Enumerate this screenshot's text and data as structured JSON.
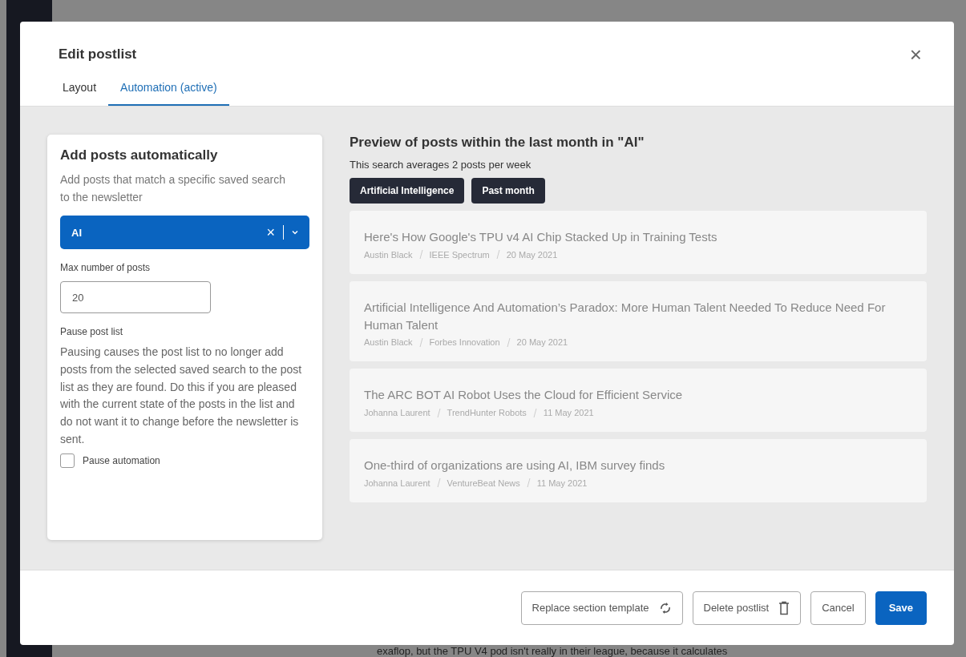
{
  "background_text": "exaflop, but the TPU V4 pod isn't really in their league, because it calculates",
  "dialog": {
    "title": "Edit postlist",
    "close": "×"
  },
  "tabs": [
    {
      "label": "Layout",
      "selected": false
    },
    {
      "label": "Automation (active)",
      "selected": true
    }
  ],
  "automation_card": {
    "title": "Add posts automatically",
    "description": "Add posts that match a specific saved search to the newsletter",
    "saved_search": {
      "value": "AI",
      "clear": "×"
    },
    "max_posts": {
      "label": "Max number of posts",
      "value": "20"
    },
    "pause": {
      "label": "Pause post list",
      "description": "Pausing causes the post list to no longer add posts from the selected saved search to the post list as they are found. Do this if you are pleased with the current state of the posts in the list and do not want it to change before the newsletter is sent.",
      "checkbox_label": "Pause automation",
      "checked": false
    }
  },
  "preview": {
    "title": "Preview of posts within the last month in \"AI\"",
    "subtitle": "This search averages 2 posts per week",
    "tags": [
      "Artificial Intelligence",
      "Past month"
    ],
    "posts": [
      {
        "title": "Here's How Google's TPU v4 AI Chip Stacked Up in Training Tests",
        "author": "Austin Black",
        "source": "IEEE Spectrum",
        "date": "20 May 2021"
      },
      {
        "title": "Artificial Intelligence And Automation’s Paradox: More Human Talent Needed To Reduce Need For Human Talent",
        "author": "Austin Black",
        "source": "Forbes Innovation",
        "date": "20 May 2021"
      },
      {
        "title": "The ARC BOT AI Robot Uses the Cloud for Efficient Service",
        "author": "Johanna Laurent",
        "source": "TrendHunter Robots",
        "date": "11 May 2021"
      },
      {
        "title": "One-third of organizations are using AI, IBM survey finds",
        "author": "Johanna Laurent",
        "source": "VentureBeat News",
        "date": "11 May 2021"
      }
    ]
  },
  "footer_buttons": [
    {
      "label": "Replace section template",
      "kind": "replace"
    },
    {
      "label": "Delete postlist",
      "kind": "delete"
    },
    {
      "label": "Cancel",
      "kind": "plain"
    },
    {
      "label": "Save",
      "kind": "primary"
    }
  ]
}
